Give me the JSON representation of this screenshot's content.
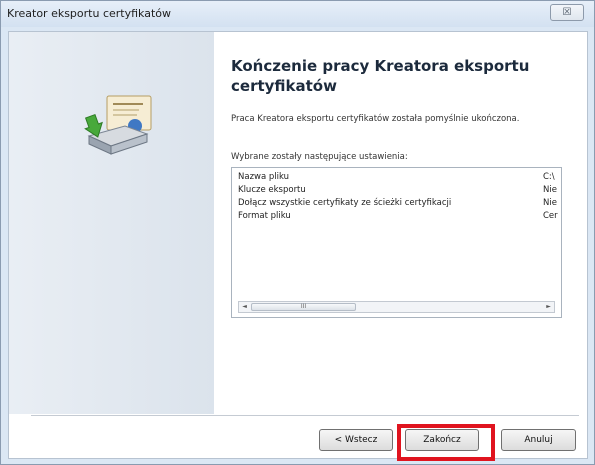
{
  "window": {
    "title": "Kreator eksportu certyfikatów",
    "close_label": "☒"
  },
  "heading": "Kończenie pracy Kreatora eksportu certyfikatów",
  "description": "Praca Kreatora eksportu certyfikatów została pomyślnie ukończona.",
  "settings_label": "Wybrane zostały następujące ustawienia:",
  "settings": [
    {
      "name": "Nazwa pliku",
      "value": "C:\\"
    },
    {
      "name": "Klucze eksportu",
      "value": "Nie"
    },
    {
      "name": "Dołącz wszystkie certyfikaty ze ścieżki certyfikacji",
      "value": "Nie"
    },
    {
      "name": "Format pliku",
      "value": "Cer"
    }
  ],
  "scrollbar": {
    "left_arrow": "◄",
    "right_arrow": "►",
    "thumb_grip": "III"
  },
  "buttons": {
    "back": "< Wstecz",
    "finish": "Zakończ",
    "cancel": "Anuluj"
  },
  "colors": {
    "highlight": "#e0141f",
    "sidebar": "#dbe3ec"
  },
  "icons": {
    "wizard": "certificate-export-icon"
  }
}
